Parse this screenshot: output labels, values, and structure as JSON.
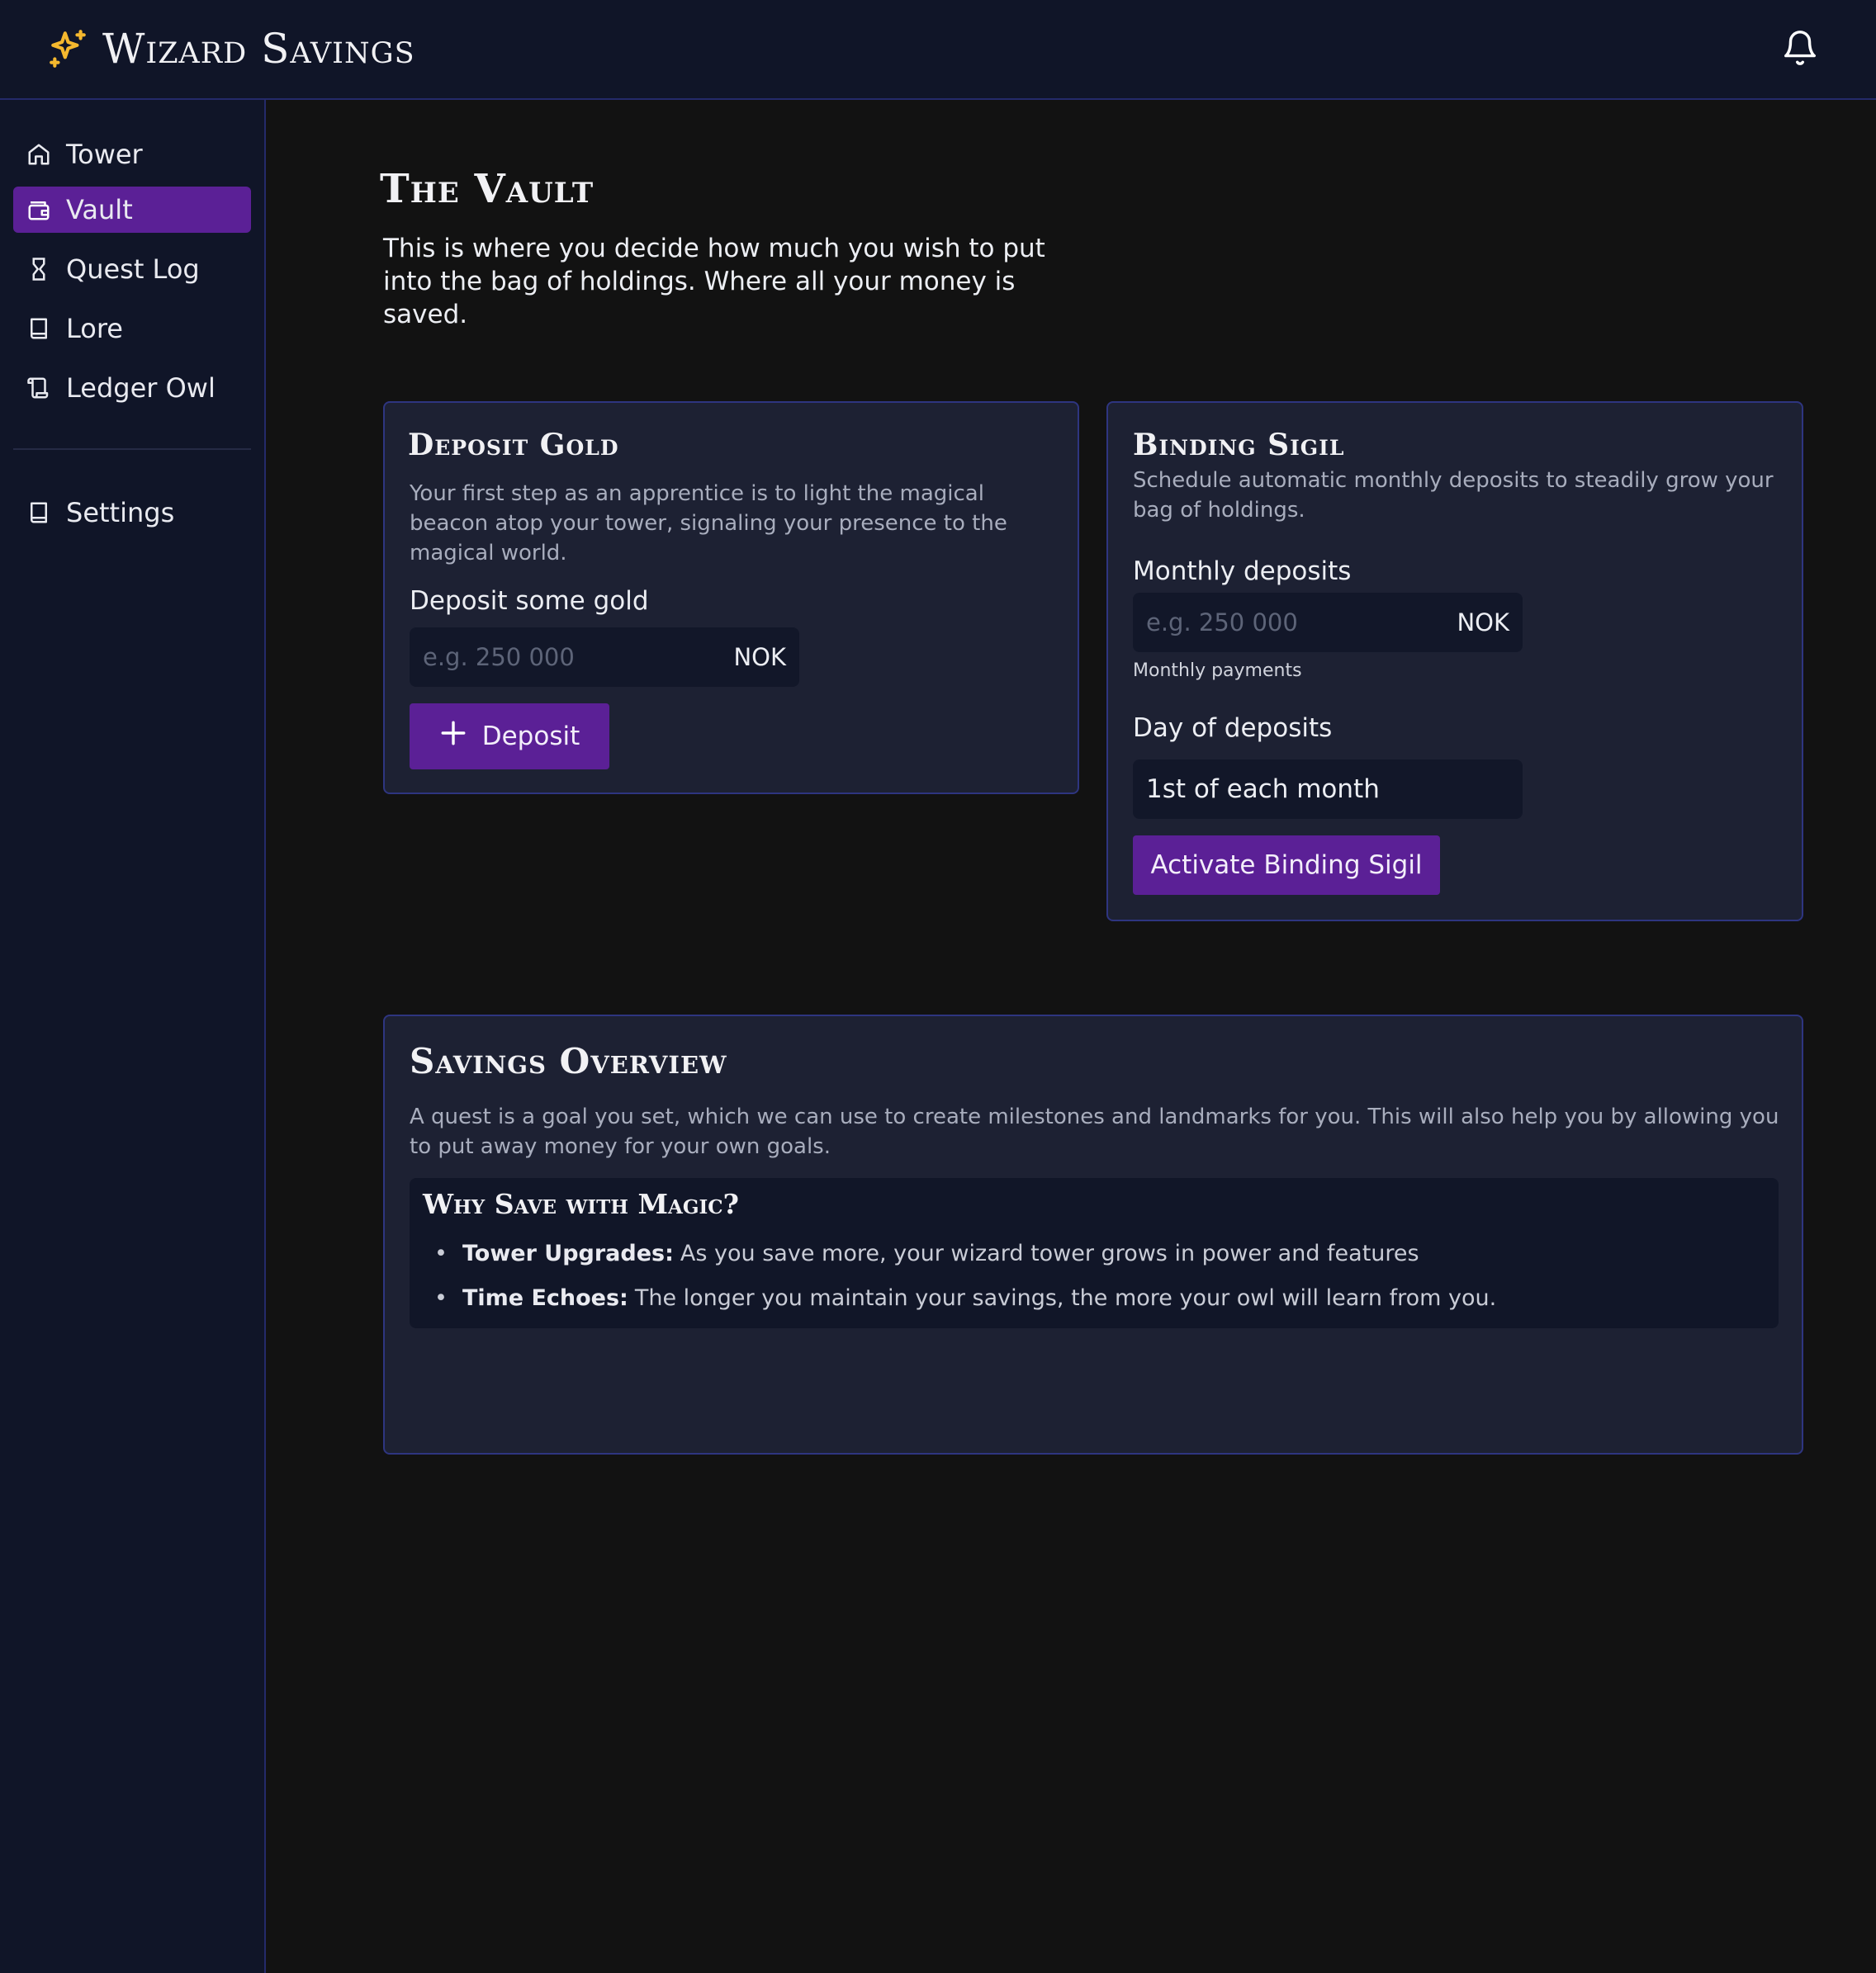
{
  "app": {
    "title": "Wizard Savings"
  },
  "header": {
    "bell_icon": "bell-icon",
    "brand_icon": "sparkle-icon",
    "brand_color": "#f5b82e"
  },
  "sidebar": {
    "items": [
      {
        "label": "Tower",
        "icon": "home-icon"
      },
      {
        "label": "Vault",
        "icon": "wallet-icon",
        "active": true
      },
      {
        "label": "Quest Log",
        "icon": "hourglass-icon"
      },
      {
        "label": "Lore",
        "icon": "book-icon"
      },
      {
        "label": "Ledger Owl",
        "icon": "scroll-icon"
      }
    ],
    "settings": {
      "label": "Settings",
      "icon": "book-icon"
    }
  },
  "page": {
    "title": "The Vault",
    "description": "This is where you decide how much you wish to put into the bag of holdings. Where all your money is saved."
  },
  "deposit_card": {
    "title": "Deposit Gold",
    "text": "Your first step as an apprentice is to light the magical beacon atop your tower, signaling your presence to the magical world.",
    "field_label": "Deposit some gold",
    "placeholder": "e.g. 250 000",
    "value": "",
    "unit": "NOK",
    "button_label": "Deposit"
  },
  "sigil_card": {
    "title": "Binding Sigil",
    "text": "Schedule automatic monthly deposits to steadily grow your bag of holdings.",
    "monthly_label": "Monthly deposits",
    "monthly_placeholder": "e.g. 250 000",
    "monthly_value": "",
    "unit": "NOK",
    "monthly_caption": "Monthly payments",
    "day_label": "Day of deposits",
    "day_value": "1st of each month",
    "button_label": "Activate Binding Sigil"
  },
  "overview_card": {
    "title": "Savings Overview",
    "text": "A quest is a goal you set, which we can use to create milestones and landmarks for you. This will also help you by allowing you to put away money for your own goals.",
    "why": {
      "title": "Why Save with Magic?",
      "items": [
        {
          "key": "Tower Upgrades:",
          "text": "As you save more, your wizard tower grows in power and features"
        },
        {
          "key": "Time Echoes:",
          "text": "The longer you maintain your savings, the more your owl will learn from you."
        }
      ]
    }
  },
  "colors": {
    "accent": "#5b2096",
    "card_bg": "#1d2133",
    "card_border": "#2e3580",
    "nav_bg": "#101528"
  }
}
